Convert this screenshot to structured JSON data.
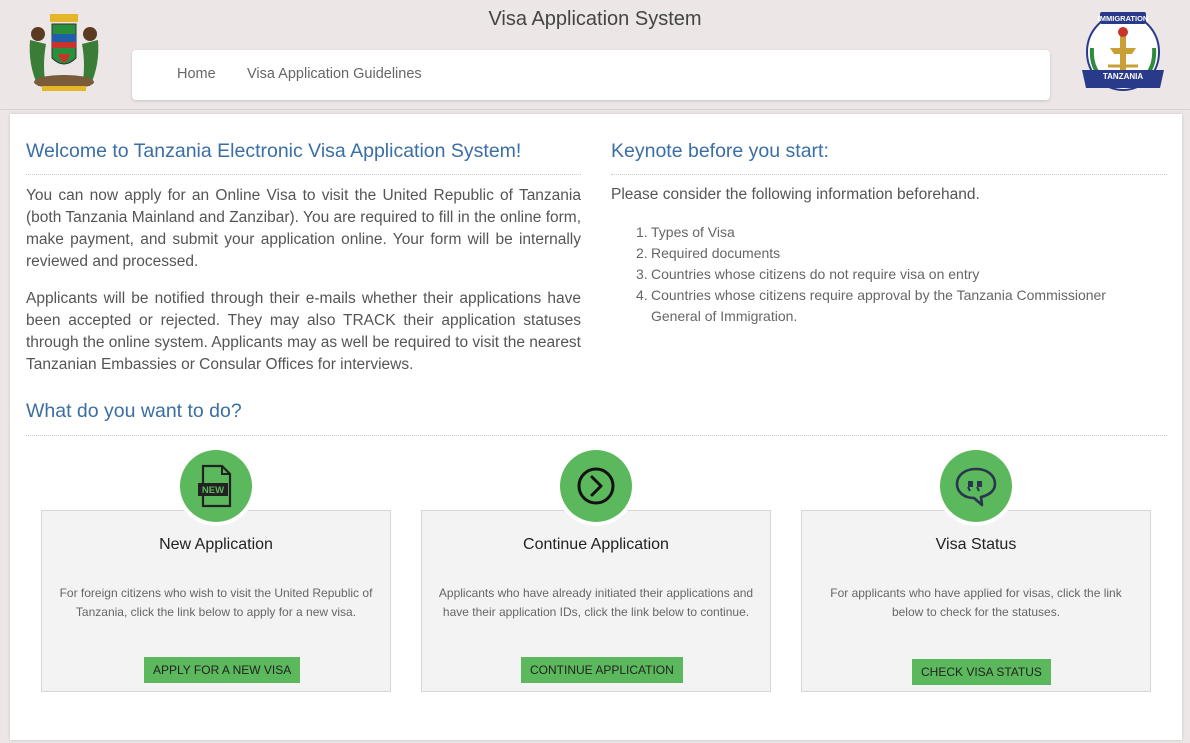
{
  "header": {
    "title": "Visa Application System",
    "left_logo": "tanzania-coat-of-arms",
    "right_logo": "immigration-tanzania-emblem",
    "right_logo_text_top": "IMMIGRATION",
    "right_logo_text_bottom": "TANZANIA"
  },
  "nav": {
    "home": "Home",
    "guidelines": "Visa Application Guidelines"
  },
  "welcome": {
    "title": "Welcome to Tanzania Electronic Visa Application System!",
    "para1": "You can now apply for an Online Visa to visit the United Republic of Tanzania (both Tanzania Mainland and Zanzibar). You are required to fill in the online form, make payment, and submit your application online. Your form will be internally reviewed and processed.",
    "para2": "Applicants will be notified through their e-mails whether their applications have been accepted or rejected. They may also TRACK their application statuses through the online system. Applicants may as well be required to visit the nearest Tanzanian Embassies or Consular Offices for interviews."
  },
  "keynote": {
    "title": "Keynote before you start:",
    "intro": "Please consider the following information beforehand.",
    "items": [
      "Types of Visa",
      "Required documents",
      "Countries whose citizens do not require visa on entry",
      "Countries whose citizens require approval by the Tanzania Commissioner General of Immigration."
    ]
  },
  "actions": {
    "title": "What do you want to do?",
    "cards": [
      {
        "icon": "new-document-icon",
        "title": "New Application",
        "desc": "For foreign citizens who wish to visit the United Republic of Tanzania, click the link below to apply for a new visa.",
        "button": "APPLY FOR A NEW VISA"
      },
      {
        "icon": "arrow-circle-right-icon",
        "title": "Continue Application",
        "desc": "Applicants who have already initiated their applications and have their application IDs, click the link below to continue.",
        "button": "CONTINUE APPLICATION"
      },
      {
        "icon": "chat-quote-icon",
        "title": "Visa Status",
        "desc": "For applicants who have applied for visas, click the link below to check for the statuses.",
        "button": "CHECK VISA STATUS"
      }
    ]
  },
  "colors": {
    "accent_green": "#5cb85c",
    "heading_blue": "#3a6ea5",
    "header_bg": "#ece6e6"
  }
}
